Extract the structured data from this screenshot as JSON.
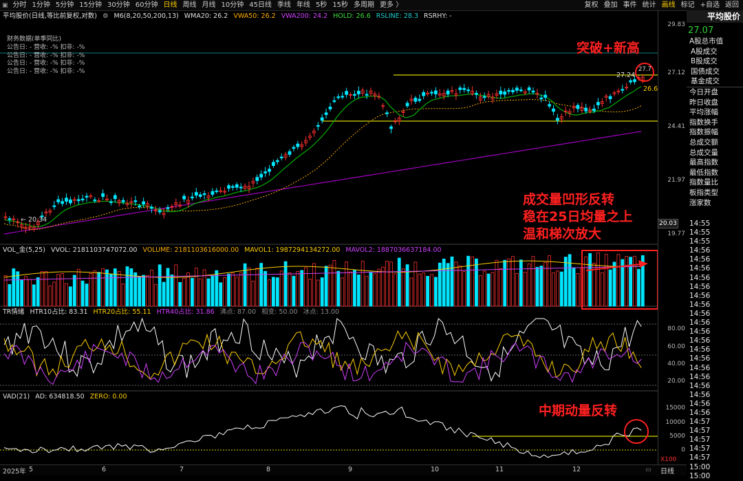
{
  "toolbar": {
    "timeframes": [
      "分时",
      "1分钟",
      "5分钟",
      "15分钟",
      "30分钟",
      "60分钟",
      "日线",
      "周线",
      "月线",
      "10分钟",
      "45日线",
      "季线",
      "年线",
      "5秒",
      "15秒",
      "多周期",
      "更多 〉"
    ],
    "active_timeframe": "日线",
    "right_buttons": [
      "复权",
      "叠加",
      "事件",
      "统计",
      "画线",
      "标记",
      "+自选",
      "返回"
    ],
    "active_right": "画线"
  },
  "main_chart": {
    "legend_title": "平均股价(日线,等比前复权,对数)",
    "ma_label": "M6(8,20,50,200,13)",
    "wma20": "WMA20: 26.2",
    "vwa50": "VWA50: 26.2",
    "vwa200": "VWA200: 24.2",
    "hold": "HOLD: 26.6",
    "rsline": "RSLINE: 28.3",
    "rsrhy": "RSRHY: -",
    "fin_title": "财务数据(单季同比)",
    "fin_rows": [
      "公告日: -   营收: -%   扣非: -%",
      "公告日: -   营收: -%   扣非: -%",
      "公告日: -   营收: -%   扣非: -%",
      "公告日: -   营收: -%   扣非: -%"
    ],
    "low_label": "← 20.34",
    "high_label": "27.24",
    "high_label2": "27.7",
    "hold_label": "26.6",
    "y_ticks": [
      "29.83",
      "27.12",
      "24.41",
      "21.97",
      "19.77"
    ],
    "last_price_box": "20.03"
  },
  "callouts": {
    "breakout": "突破+新高",
    "volume_lines": [
      "成交量凹形反转",
      "稳在25日均量之上",
      "温和梯次放大"
    ],
    "momentum": "中期动量反转"
  },
  "volume_panel": {
    "title": "VOL_金(5,25)",
    "vvol": "VVOL: 2181103747072.00",
    "volume": "VOLUME: 2181103616000.00",
    "mavol1": "MAVOL1: 1987294134272.00",
    "mavol2": "MAVOL2: 1887036637184.00"
  },
  "tr_panel": {
    "title": "TR情绪",
    "htr10": "HTR10占比: 83.31",
    "htr20": "HTR20占比: 55.11",
    "htr40": "HTR40占比: 31.86",
    "boil": "沸点: 87.00",
    "mid": "相变: 50.00",
    "freeze": "冰点: 13.00",
    "y_ticks": [
      "80.00",
      "60.00",
      "40.00",
      "20.00"
    ]
  },
  "vad_panel": {
    "title": "VAD(21)",
    "ad": "AD: 634818.50",
    "zero": "ZERO: 0.00",
    "y_ticks": [
      "15000",
      "10000",
      "5000",
      "0"
    ],
    "unit": "X100"
  },
  "x_axis": {
    "labels": [
      "2025年",
      "5",
      "6",
      "7",
      "8",
      "9",
      "10",
      "11",
      "12"
    ],
    "period_tab": "日线"
  },
  "right_panel": {
    "title": "平均股价",
    "value": "27.07",
    "labels": [
      "A股总市值",
      "A股成交",
      "B股成交",
      "国债成交",
      "基金成交",
      "今日开盘",
      "昨日收盘",
      "平均涨幅",
      "指数换手",
      "指数振幅",
      "总成交额",
      "总成交量",
      "最高指数",
      "最低指数",
      "指数量比",
      "板指类型",
      "涨家数"
    ],
    "times": [
      "14:55",
      "14:55",
      "14:55",
      "14:56",
      "14:56",
      "14:56",
      "14:56",
      "14:56",
      "14:56",
      "14:56",
      "14:56",
      "14:56",
      "14:56",
      "14:56",
      "14:56",
      "14:56",
      "14:56",
      "14:56",
      "14:56",
      "14:56",
      "14:56",
      "14:56",
      "14:57",
      "14:57",
      "14:57",
      "14:57",
      "14:57",
      "15:00",
      "15:00"
    ]
  },
  "colors": {
    "up": "#ff3030",
    "down": "#00e6ff",
    "ma_green": "#00c000",
    "ma_orange": "#ffb000",
    "ma_purple": "#b000d0",
    "yellow": "#e8e800",
    "callout": "#ff2020"
  }
}
